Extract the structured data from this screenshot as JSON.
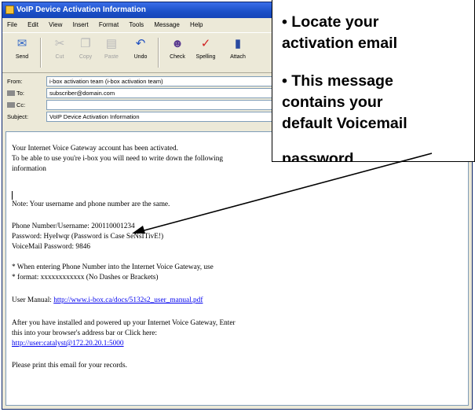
{
  "window": {
    "title": "VoIP Device Activation Information"
  },
  "menu": [
    "File",
    "Edit",
    "View",
    "Insert",
    "Format",
    "Tools",
    "Message",
    "Help"
  ],
  "toolbar": [
    {
      "label": "Send",
      "icon": "send-icon",
      "enabled": true
    },
    {
      "label": "Cut",
      "icon": "cut-icon",
      "enabled": false
    },
    {
      "label": "Copy",
      "icon": "copy-icon",
      "enabled": false
    },
    {
      "label": "Paste",
      "icon": "paste-icon",
      "enabled": false
    },
    {
      "label": "Undo",
      "icon": "undo-icon",
      "enabled": true
    },
    {
      "label": "Check",
      "icon": "check-names-icon",
      "enabled": true
    },
    {
      "label": "Spelling",
      "icon": "spelling-icon",
      "enabled": true
    },
    {
      "label": "Attach",
      "icon": "attach-icon",
      "enabled": true
    }
  ],
  "headers": {
    "from_label": "From:",
    "from_value": "i-box activation team   (i-box activation team)",
    "to_label": "To:",
    "to_value": "subscriber@domain.com",
    "cc_label": "Cc:",
    "cc_value": "",
    "subject_label": "Subject:",
    "subject_value": "VoIP Device Activation Information"
  },
  "body": {
    "line1": "Your Internet Voice Gateway account has been activated.",
    "line2": "To be able to use you're i-box you will need to write down the following",
    "line3": "information",
    "note": "Note: Your username and phone number are the same.",
    "phone": "Phone Number/Username:  200110001234",
    "password": "Password:  HyeIwqr (Password is Case SeNsITivE!)",
    "voicemail": "VoiceMail Password:  9846",
    "hint1": "* When entering Phone Number into the Internet Voice Gateway, use",
    "hint2": "* format: xxxxxxxxxxxx (No Dashes or Brackets)",
    "manual_label": "User Manual:",
    "manual_link": "http://www.i-box.ca/docs/5132s2_user_manual.pdf",
    "after1": "After you have installed and powered up your Internet Voice Gateway, Enter",
    "after2": "this into your browser's address bar or Click here:",
    "gateway_link": "http://user:catalyst@172.20.20.1:5000",
    "print": "Please print this email for your records."
  },
  "callout": {
    "line1": "• Locate your",
    "line2": "activation email",
    "line3": "• This message",
    "line4": "contains your",
    "line5": "default Voicemail",
    "line6": "password"
  }
}
